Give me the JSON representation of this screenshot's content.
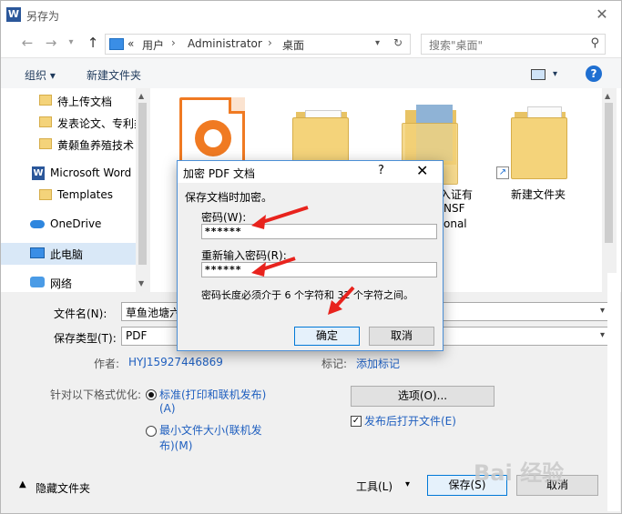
{
  "window": {
    "title": "另存为",
    "app_icon_letter": "W"
  },
  "nav": {
    "path": [
      "用户",
      "Administrator",
      "桌面"
    ],
    "path_prefix": "«",
    "search_placeholder": "搜索\"桌面\""
  },
  "toolbar": {
    "organize": "组织 ▾",
    "new_folder": "新建文件夹"
  },
  "sidebar": {
    "items": [
      {
        "label": "待上传文档",
        "icon": "folder-icon"
      },
      {
        "label": "发表论文、专利类",
        "icon": "folder-icon"
      },
      {
        "label": "黄颡鱼养殖技术",
        "icon": "folder-icon"
      },
      {
        "label": "Microsoft Word",
        "icon": "word-icon"
      },
      {
        "label": "Templates",
        "icon": "folder-icon"
      },
      {
        "label": "OneDrive",
        "icon": "cloud-icon"
      },
      {
        "label": "此电脑",
        "icon": "pc-icon"
      },
      {
        "label": "网络",
        "icon": "network-icon"
      }
    ]
  },
  "files": {
    "items": [
      {
        "label": "",
        "type": "pdf"
      },
      {
        "label": "",
        "type": "folder"
      },
      {
        "label": "入证有",
        "type": "photo-folder"
      },
      {
        "label": "新建文件夹",
        "type": "folder"
      }
    ],
    "partial_labels": [
      "NSF",
      "onal"
    ]
  },
  "form": {
    "filename_label": "文件名(N):",
    "filename_value": "草鱼池塘六",
    "filetype_label": "保存类型(T):",
    "filetype_value": "PDF",
    "author_label": "作者:",
    "author_value": "HYJ15927446869",
    "tags_label": "标记:",
    "tags_value": "添加标记",
    "optimize_label": "针对以下格式优化:",
    "option_standard_line1": "标准(打印和联机发布)",
    "option_standard_line2": "(A)",
    "option_min_line1": "最小文件大小(联机发",
    "option_min_line2": "布)(M)",
    "options_button": "选项(O)...",
    "open_after_publish": "发布后打开文件(E)",
    "hide_folders": "隐藏文件夹",
    "tools": "工具(L)",
    "save": "保存(S)",
    "cancel": "取消"
  },
  "dialog": {
    "title": "加密 PDF 文档",
    "help": "?",
    "close": "✕",
    "intro": "保存文档时加密。",
    "password_label": "密码(W):",
    "password_value": "******",
    "reenter_label": "重新输入密码(R):",
    "reenter_value": "******",
    "hint": "密码长度必须介于 6 个字符和 32 个字符之间。",
    "ok": "确定",
    "cancel": "取消"
  },
  "watermark": "Bai 经验",
  "colors": {
    "accent": "#0078d7",
    "link": "#1f5fbf",
    "annotation": "#e8231d"
  }
}
